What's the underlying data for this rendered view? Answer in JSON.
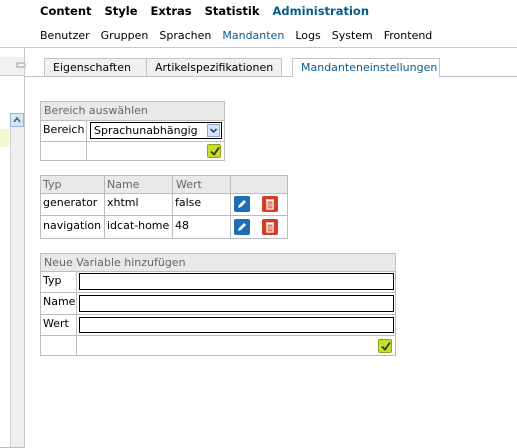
{
  "nav": {
    "main": [
      "Content",
      "Style",
      "Extras",
      "Statistik",
      "Administration"
    ],
    "main_active": "Administration",
    "sub": [
      "Benutzer",
      "Gruppen",
      "Sprachen",
      "Mandanten",
      "Logs",
      "System",
      "Frontend"
    ],
    "sub_active": "Mandanten"
  },
  "tabs": [
    "Eigenschaften",
    "Artikelspezifikationen",
    "Mandanteneinstellungen"
  ],
  "tabs_active": "Mandanteneinstellungen",
  "bereich": {
    "title": "Bereich auswählen",
    "label": "Bereich",
    "selected": "Sprachunabhängig"
  },
  "vars": {
    "headers": {
      "typ": "Typ",
      "name": "Name",
      "wert": "Wert"
    },
    "rows": [
      {
        "typ": "generator",
        "name": "xhtml",
        "wert": "false"
      },
      {
        "typ": "navigation",
        "name": "idcat-home",
        "wert": "48"
      }
    ]
  },
  "neu": {
    "title": "Neue Variable hinzufügen",
    "typ_label": "Typ",
    "name_label": "Name",
    "wert_label": "Wert"
  },
  "colors": {
    "accent": "#0b5a8f",
    "ok": "#c8dd2a",
    "edit": "#1c6fb5",
    "delete": "#d43d25"
  }
}
